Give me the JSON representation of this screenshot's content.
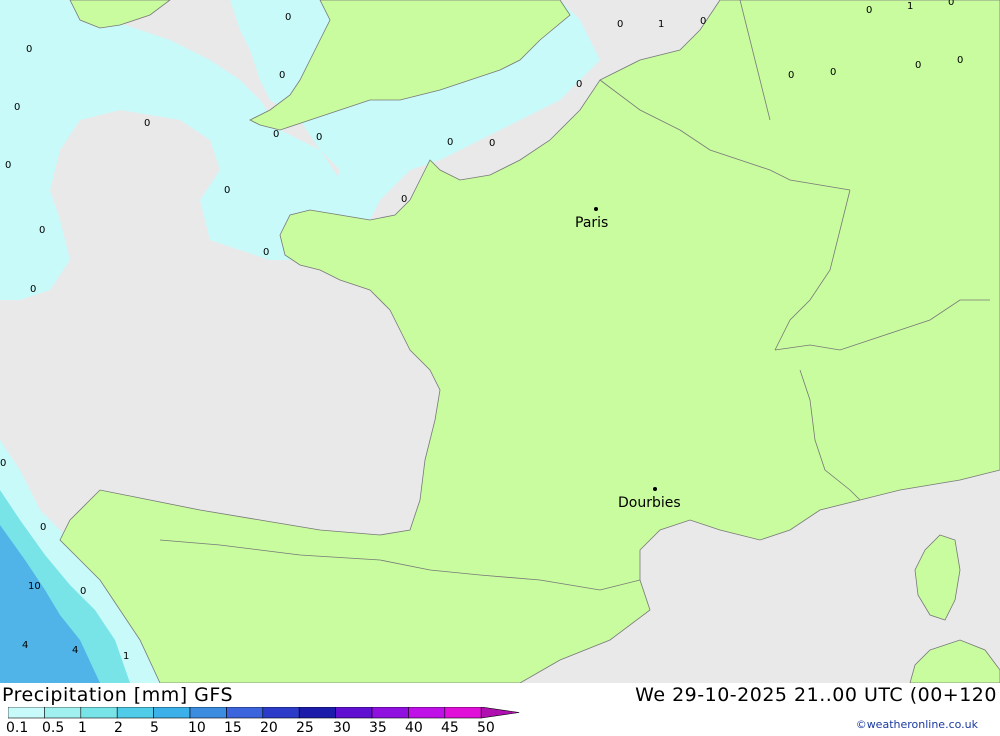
{
  "footer": {
    "title": "Precipitation [mm] GFS",
    "datetime": "We 29-10-2025 21..00 UTC (00+120",
    "credit": "©weatheronline.co.uk"
  },
  "legend": {
    "ticks": [
      "0.1",
      "0.5",
      "1",
      "2",
      "5",
      "10",
      "15",
      "20",
      "25",
      "30",
      "35",
      "40",
      "45",
      "50"
    ],
    "colors": [
      "#c8fafa",
      "#a0f0f0",
      "#78e4e8",
      "#50cce8",
      "#3cb0e8",
      "#3c8ce0",
      "#3c64dc",
      "#2c3cc8",
      "#1c1caa",
      "#6010d0",
      "#9010e0",
      "#c010e8",
      "#e010d8",
      "#b010b0"
    ]
  },
  "cities": [
    {
      "name": "Paris"
    },
    {
      "name": "Dourbies"
    }
  ],
  "values": [
    "0",
    "0",
    "1",
    "0",
    "0",
    "1",
    "0",
    "0",
    "0",
    "0",
    "0",
    "0",
    "0",
    "0",
    "0",
    "0",
    "0",
    "0",
    "0",
    "0",
    "0",
    "0",
    "0",
    "0",
    "0",
    "0",
    "10",
    "0",
    "4",
    "4",
    "1"
  ],
  "colors": {
    "sea": "#e9e9e9",
    "land": "#c8fc9e",
    "border": "#787878",
    "light_precip": "#c8fafa",
    "mid_precip": "#78e4e8",
    "heavy_precip": "#50b4e8"
  }
}
